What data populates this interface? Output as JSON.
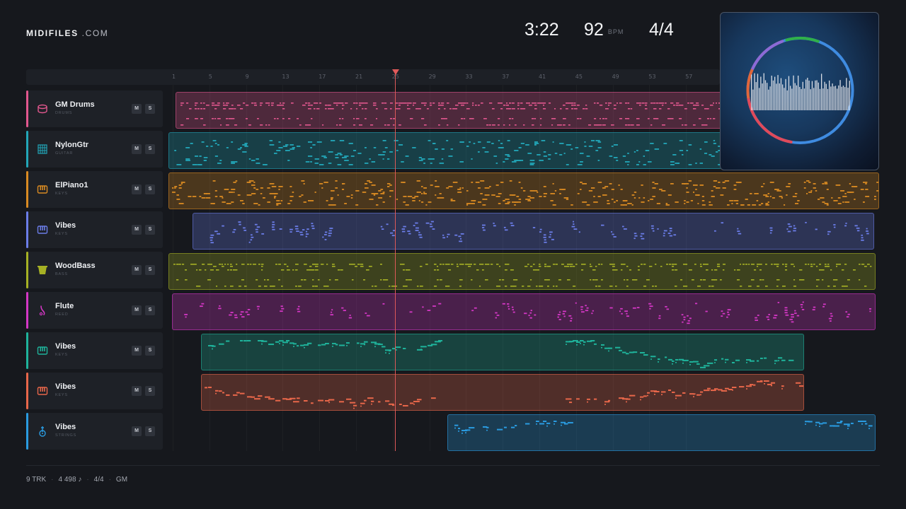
{
  "brand": {
    "name_bold": "MIDIFILES",
    "name_light": " .COM"
  },
  "transport": {
    "time": "3:22",
    "bpm": "92",
    "bpm_unit": "BPM",
    "signature": "4/4"
  },
  "ruler": {
    "ticks": [
      "1",
      "5",
      "9",
      "13",
      "17",
      "21",
      "25",
      "29",
      "33",
      "37",
      "41",
      "45",
      "49",
      "53",
      "57"
    ]
  },
  "buttons": {
    "mute": "M",
    "solo": "S"
  },
  "tracks": [
    {
      "name": "GM Drums",
      "category": "DRUMS",
      "color": "#e2578e",
      "icon": "drum-icon",
      "clip_start": 0.01,
      "clip_end": 0.8,
      "density": 1.0,
      "style": "rows"
    },
    {
      "name": "NylonGtr",
      "category": "GUITAR",
      "color": "#22a6b8",
      "icon": "guitar-icon",
      "clip_start": 0.0,
      "clip_end": 0.78,
      "density": 0.9,
      "style": "dense"
    },
    {
      "name": "ElPiano1",
      "category": "KEYS",
      "color": "#d98a22",
      "icon": "piano-icon",
      "clip_start": 0.0,
      "clip_end": 1.0,
      "density": 1.0,
      "style": "dense"
    },
    {
      "name": "Vibes",
      "category": "KEYS",
      "color": "#6b7de8",
      "icon": "piano-icon",
      "clip_start": 0.034,
      "clip_end": 0.993,
      "density": 0.5,
      "style": "sparse"
    },
    {
      "name": "WoodBass",
      "category": "BASS",
      "color": "#a6b124",
      "icon": "bass-icon",
      "clip_start": 0.0,
      "clip_end": 0.995,
      "density": 0.8,
      "style": "rows"
    },
    {
      "name": "Flute",
      "category": "REED",
      "color": "#d437c5",
      "icon": "flute-icon",
      "clip_start": 0.005,
      "clip_end": 0.995,
      "density": 0.45,
      "style": "sparse"
    },
    {
      "name": "Vibes",
      "category": "KEYS",
      "color": "#1fb39b",
      "icon": "piano-icon",
      "clip_start": 0.046,
      "clip_end": 0.895,
      "density": 0.35,
      "style": "melody"
    },
    {
      "name": "Vibes",
      "category": "KEYS",
      "color": "#e8674a",
      "icon": "piano-icon",
      "clip_start": 0.046,
      "clip_end": 0.895,
      "density": 0.35,
      "style": "melody"
    },
    {
      "name": "Vibes",
      "category": "STRINGS",
      "color": "#2a9be0",
      "icon": "strings-icon",
      "clip_start": 0.391,
      "clip_end": 0.995,
      "density": 0.25,
      "style": "melody2"
    }
  ],
  "playhead": {
    "position": 0.32
  },
  "footer": {
    "tracks": "9 TRK",
    "notes": "4 498 ♪",
    "signature": "4/4",
    "standard": "GM"
  }
}
